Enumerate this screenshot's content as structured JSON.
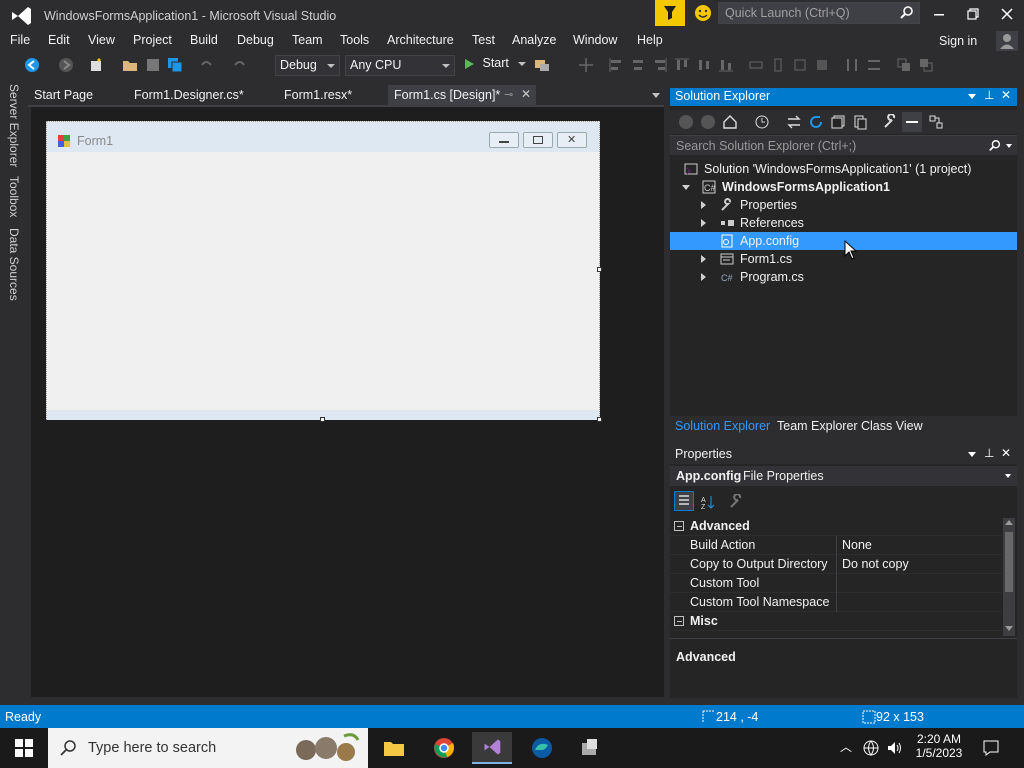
{
  "window": {
    "title": "WindowsFormsApplication1 - Microsoft Visual Studio",
    "quick_launch_placeholder": "Quick Launch (Ctrl+Q)"
  },
  "menu": [
    "File",
    "Edit",
    "View",
    "Project",
    "Build",
    "Debug",
    "Team",
    "Tools",
    "Architecture",
    "Test",
    "Analyze",
    "Window",
    "Help"
  ],
  "account": {
    "signin_label": "Sign in"
  },
  "toolbar": {
    "configuration": "Debug",
    "platform": "Any CPU",
    "start_label": "Start"
  },
  "side_rail": [
    "Server Explorer",
    "Toolbox",
    "Data Sources"
  ],
  "doc_tabs": [
    "Start Page",
    "Form1.Designer.cs*",
    "Form1.resx*",
    "Form1.cs [Design]*"
  ],
  "designer": {
    "form_title": "Form1"
  },
  "solution_explorer": {
    "header": "Solution Explorer",
    "search_placeholder": "Search Solution Explorer (Ctrl+;)",
    "tree": [
      {
        "label": "Solution 'WindowsFormsApplication1' (1 project)"
      },
      {
        "label": "WindowsFormsApplication1"
      },
      {
        "label": "Properties"
      },
      {
        "label": "References"
      },
      {
        "label": "App.config"
      },
      {
        "label": "Form1.cs"
      },
      {
        "label": "Program.cs"
      }
    ],
    "tabs": [
      "Solution Explorer",
      "Team Explorer",
      "Class View"
    ]
  },
  "properties": {
    "header": "Properties",
    "object_name": "App.config",
    "object_type": "File Properties",
    "categories": [
      {
        "name": "Advanced"
      },
      {
        "name": "Misc"
      }
    ],
    "rows": [
      {
        "name": "Build Action",
        "value": "None"
      },
      {
        "name": "Copy to Output Directory",
        "value": "Do not copy"
      },
      {
        "name": "Custom Tool",
        "value": ""
      },
      {
        "name": "Custom Tool Namespace",
        "value": ""
      }
    ],
    "description_title": "Advanced"
  },
  "status": {
    "text": "Ready",
    "position": "214 , -4",
    "size": "92 x 153"
  },
  "taskbar": {
    "search_placeholder": "Type here to search",
    "time": "2:20 AM",
    "date": "1/5/2023"
  },
  "colors": {
    "accent": "#007acc",
    "selection": "#3399ff",
    "notification": "#f4c800"
  }
}
